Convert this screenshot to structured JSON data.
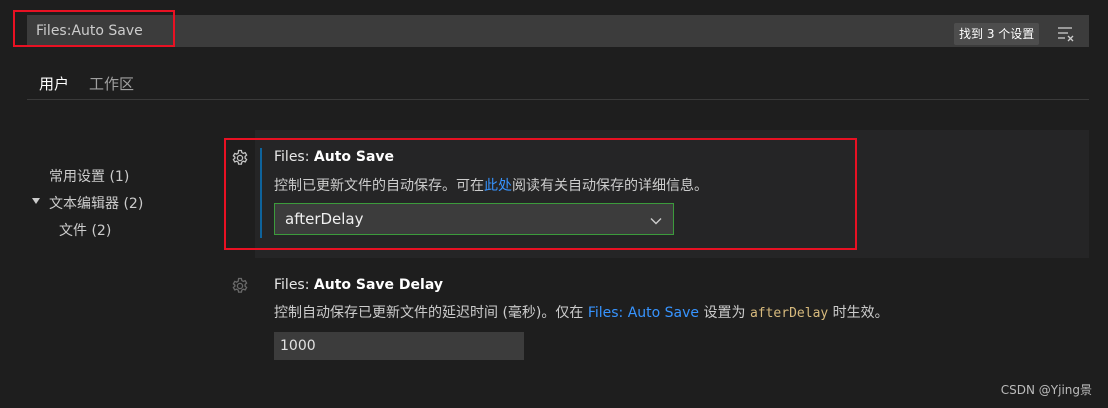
{
  "search": {
    "value": "Files:Auto Save",
    "found_label": "找到 3 个设置"
  },
  "tabs": [
    {
      "label": "用户",
      "active": true
    },
    {
      "label": "工作区",
      "active": false
    }
  ],
  "toc": [
    {
      "label": "常用设置 (1)"
    },
    {
      "label": "文本编辑器 (2)",
      "expanded": true
    },
    {
      "label": "文件 (2)"
    }
  ],
  "settings": [
    {
      "category": "Files: ",
      "name": "Auto Save",
      "desc_before": "控制已更新文件的自动保存。可在",
      "desc_link": "此处",
      "desc_after": "阅读有关自动保存的详细信息。",
      "value": "afterDelay"
    },
    {
      "category": "Files: ",
      "name": "Auto Save Delay",
      "desc_before": "控制自动保存已更新文件的延迟时间 (毫秒)。仅在 ",
      "desc_link": "Files: Auto Save",
      "desc_middle": " 设置为 ",
      "desc_code": "afterDelay",
      "desc_after": " 时生效。",
      "value": "1000"
    }
  ],
  "watermark": "CSDN @Yjing景",
  "colors": {
    "highlight": "#e81123",
    "link": "#3794ff",
    "focus_bar": "#0e639c"
  }
}
